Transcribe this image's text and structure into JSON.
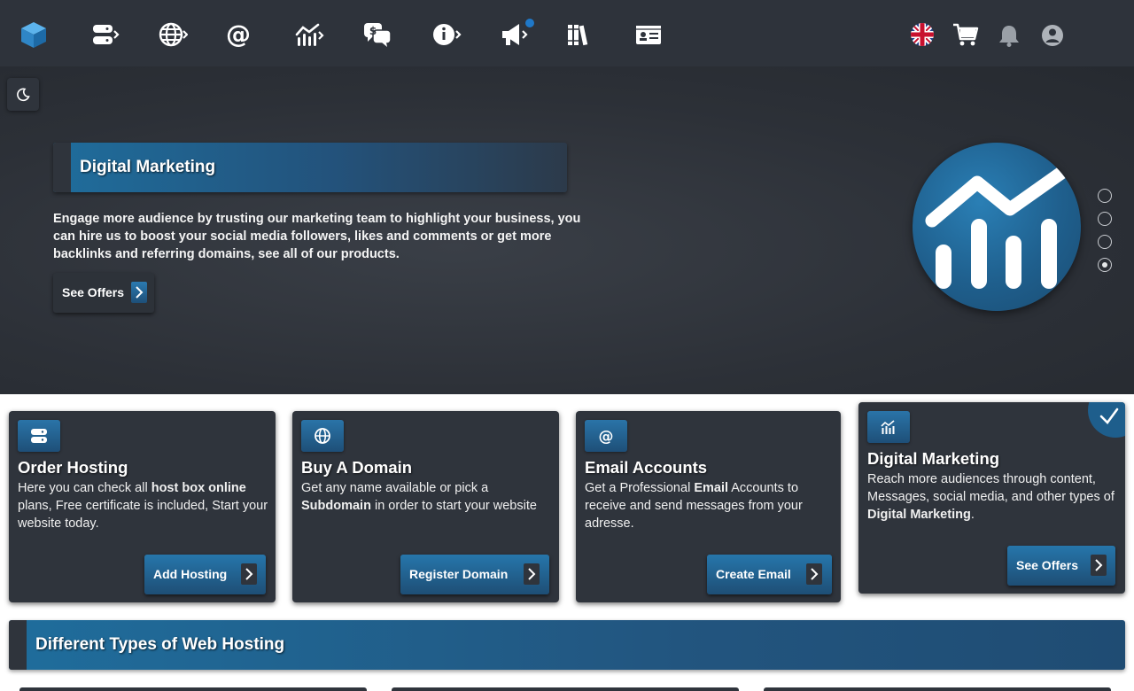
{
  "nav": {
    "items": [
      {
        "icon": "cube-logo-icon"
      },
      {
        "icon": "server-icon"
      },
      {
        "icon": "globe-icon"
      },
      {
        "icon": "at-sign-icon"
      },
      {
        "icon": "chart-icon"
      },
      {
        "icon": "dollar-chat-icon"
      },
      {
        "icon": "info-icon"
      },
      {
        "icon": "megaphone-icon"
      },
      {
        "icon": "library-icon"
      },
      {
        "icon": "id-card-icon"
      }
    ],
    "right": [
      {
        "icon": "uk-flag-icon"
      },
      {
        "icon": "cart-icon"
      },
      {
        "icon": "bell-icon"
      },
      {
        "icon": "user-icon"
      }
    ]
  },
  "theme_toggle": {
    "icon": "moon-icon"
  },
  "hero": {
    "title": "Digital Marketing",
    "text": "Engage more audience by trusting our marketing team to highlight your business, you can hire us to boost your social media followers, likes and comments or get more backlinks and referring domains, see all of our products.",
    "button": "See Offers",
    "slides_total": 4,
    "active_slide": 4
  },
  "cards": [
    {
      "title": "Order Hosting",
      "desc_parts": [
        "Here you can check all ",
        "host box online",
        " plans, Free certificate is included, Start your website today."
      ],
      "button": "Add Hosting",
      "icon": "server-icon"
    },
    {
      "title": "Buy A Domain",
      "desc_parts": [
        "Get any name available or pick a ",
        "Subdomain",
        " in order to start your website"
      ],
      "button": "Register Domain",
      "icon": "globe-icon"
    },
    {
      "title": "Email Accounts",
      "desc_parts": [
        "Get a Professional ",
        "Email",
        " Accounts to receive and send messages from your adresse."
      ],
      "button": "Create Email",
      "icon": "at-sign-icon"
    },
    {
      "title": "Digital Marketing",
      "desc_parts": [
        "Reach more audiences through content, Messages, social media, and other types of ",
        "Digital Marketing",
        "."
      ],
      "button": "See Offers",
      "icon": "chart-icon",
      "selected": true
    }
  ],
  "section": {
    "title": "Different Types of Web Hosting"
  },
  "colors": {
    "accent": "#1f6d9c",
    "panel": "#2f343c",
    "topbar": "#2e333b"
  }
}
